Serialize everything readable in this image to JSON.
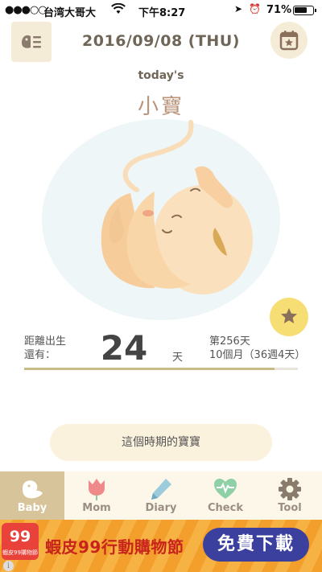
{
  "status_bar": {
    "signal": "●●●○○",
    "carrier": "台湾大哥大",
    "time": "下午8:27",
    "battery_percent": "71%",
    "battery_level": 0.71
  },
  "header": {
    "date": "2016/09/08 (THU)",
    "menu_icon": "menu-icon",
    "calendar_icon": "calendar-star-icon"
  },
  "today": {
    "label": "today's",
    "baby_name": "小寶"
  },
  "countdown": {
    "label_line1": "距離出生",
    "label_line2": "還有：",
    "days_left": "24",
    "unit": "天",
    "day_number": "第256天",
    "age": "10個月（36週4天）",
    "progress": 0.914
  },
  "period_button": "這個時期的寶寶",
  "tabs": [
    {
      "label": "Baby",
      "icon": "bird-icon",
      "active": true
    },
    {
      "label": "Mom",
      "icon": "tulip-icon",
      "active": false
    },
    {
      "label": "Diary",
      "icon": "pen-icon",
      "active": false
    },
    {
      "label": "Check",
      "icon": "heart-pulse-icon",
      "active": false
    },
    {
      "label": "Tool",
      "icon": "gear-icon",
      "active": false
    }
  ],
  "ad": {
    "logo_text": "99",
    "logo_sub": "蝦皮99購物節",
    "text": "蝦皮99行動購物節",
    "cta": "免費下載",
    "info": "i"
  },
  "colors": {
    "accent": "#d7c49a",
    "title": "#6f6658",
    "name": "#b8937a",
    "star_button": "#f7de74",
    "tab_inactive": "#9a8f80"
  }
}
